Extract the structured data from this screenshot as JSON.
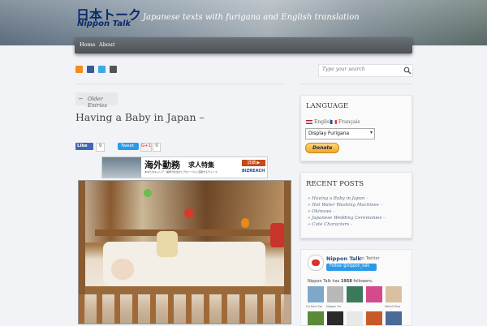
{
  "header": {
    "logo_jp": "日本トーク",
    "logo_en": "Nippon Talk",
    "tagline": "Japanese texts with furigana and English translation"
  },
  "nav": [
    {
      "label": "Home"
    },
    {
      "label": "About"
    }
  ],
  "search": {
    "placeholder": "Type your search"
  },
  "older_entries": "Older Entries",
  "post": {
    "title": "Having a Baby in Japan –"
  },
  "share": {
    "like": "Like",
    "like_count": "9",
    "tweet": "Tweet",
    "gplus": "G+1",
    "gplus_count": "0"
  },
  "banner": {
    "main": "海外勤務",
    "sub": "求人特集",
    "small": "あなたのキャリア・語学力を生かしグローバルに活躍するチャンス",
    "button": "詳細 ▶",
    "brand": "BIZREACH"
  },
  "sidebar": {
    "language": {
      "title": "LANGUAGE",
      "english": "English",
      "french": "Français",
      "select": "Display Furigana",
      "donate": "Donate"
    },
    "recent": {
      "title": "RECENT POSTS",
      "items": [
        "Having a Baby in Japan –",
        "Hot Water Washing Machines –",
        "Okinawa –",
        "Japanese Wedding Ceremonies –",
        "Cute Characters –"
      ]
    },
    "twitter": {
      "name": "Nippon Talk",
      "on": "on Twitter",
      "follow": "Follow @nippon_talk",
      "followers_prefix": "Nippon Talk has",
      "followers": "1958",
      "followers_suffix": "followers.",
      "names": [
        "Ca Dam Do",
        "Nippon Hu",
        "Mehdi Siva"
      ]
    }
  }
}
